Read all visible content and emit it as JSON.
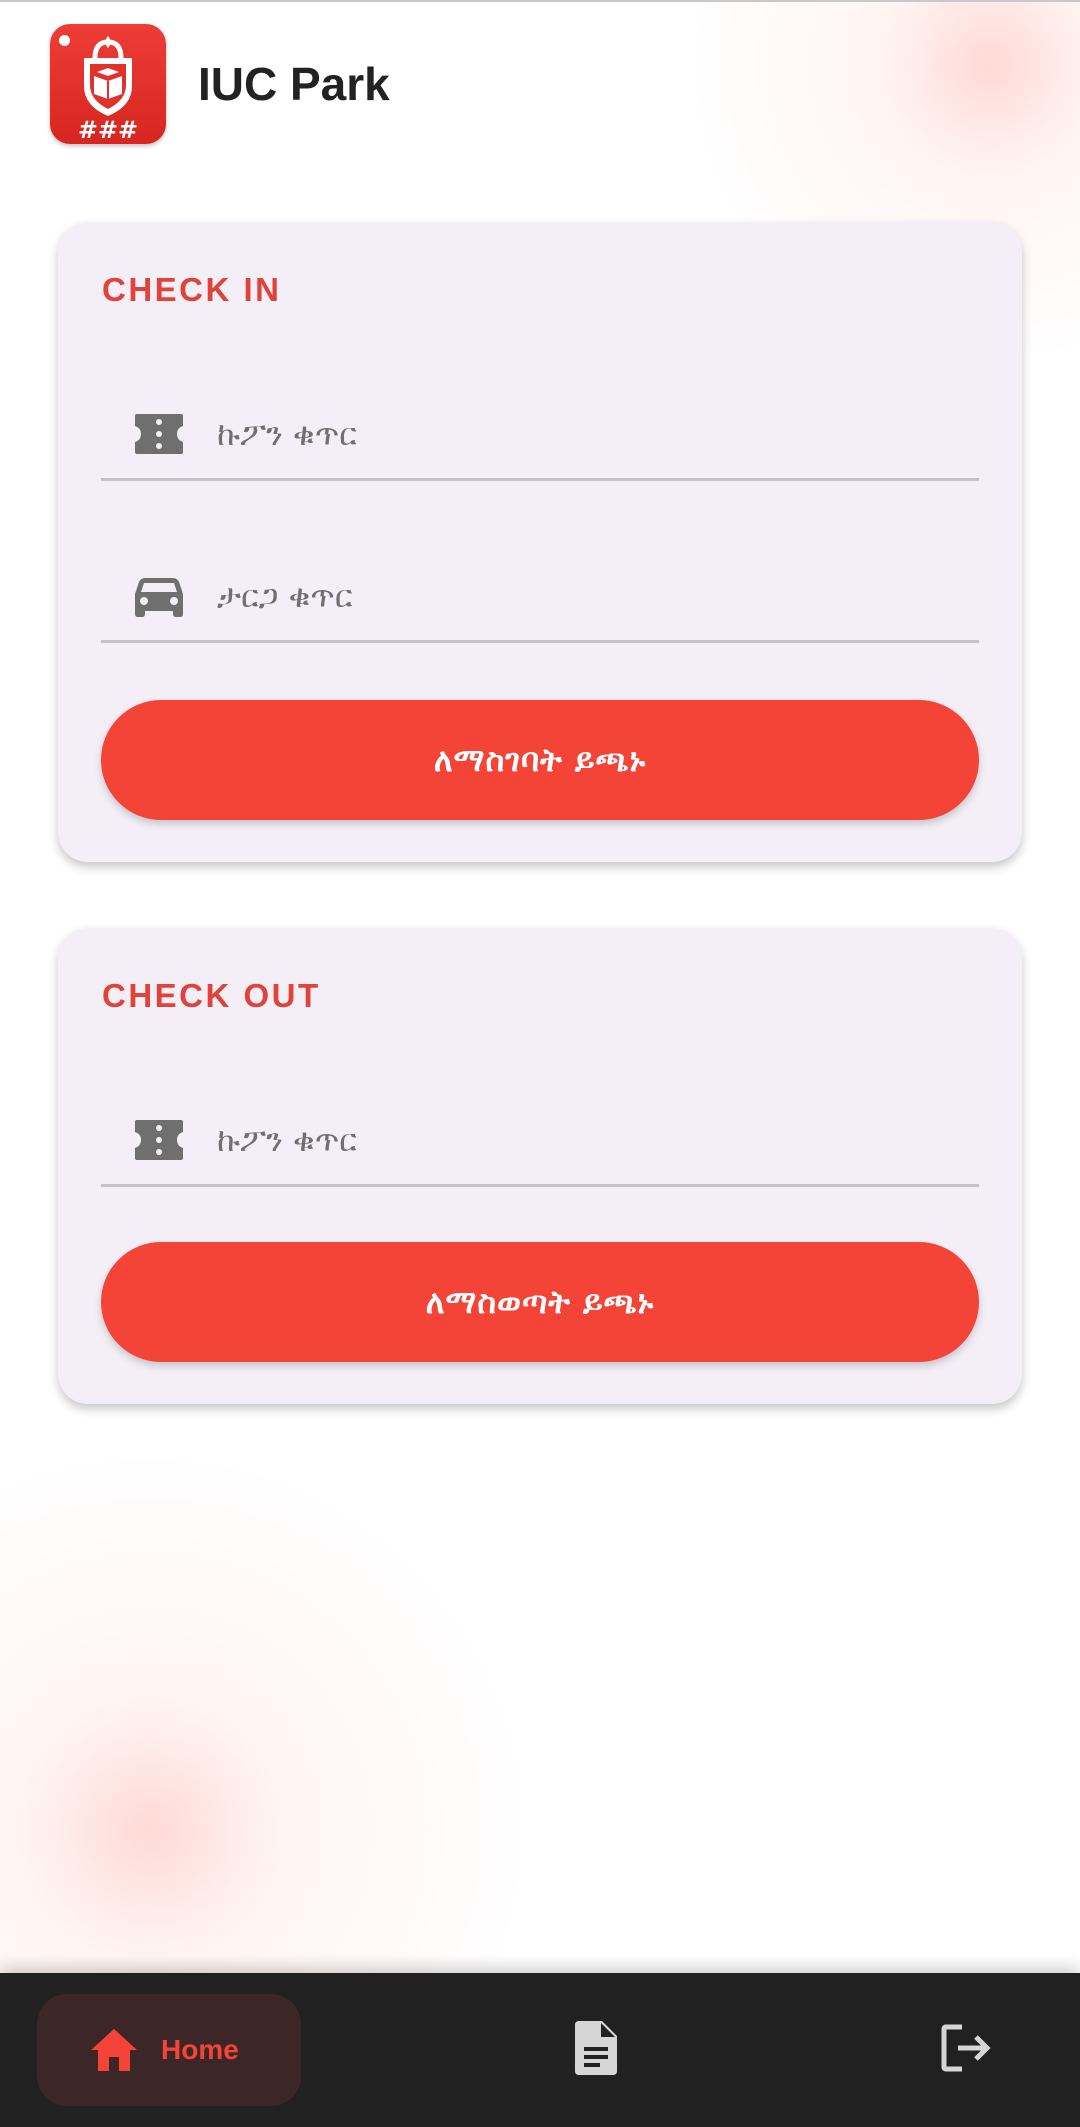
{
  "header": {
    "app_name": "IUC Park",
    "logo_icon": "shield-lock-book-icon",
    "logo_text": "###"
  },
  "check_in": {
    "title": "CHECK IN",
    "coupon_field": {
      "placeholder": "ኩፖን ቁጥር",
      "value": "",
      "icon": "ticket-icon"
    },
    "plate_field": {
      "placeholder": "ታርጋ ቁጥር",
      "value": "",
      "icon": "car-icon"
    },
    "button_label": "ለማስገባት ይጫኑ"
  },
  "check_out": {
    "title": "CHECK OUT",
    "coupon_field": {
      "placeholder": "ኩፖን ቁጥር",
      "value": "",
      "icon": "ticket-icon"
    },
    "button_label": "ለማስወጣት ይጫኑ"
  },
  "bottom_nav": {
    "items": [
      {
        "label": "Home",
        "icon": "home-icon",
        "active": true
      },
      {
        "label": "",
        "icon": "document-icon",
        "active": false
      },
      {
        "label": "",
        "icon": "logout-icon",
        "active": false
      }
    ]
  },
  "colors": {
    "accent": "#f44337",
    "title_red": "#e0433a",
    "card_bg": "#f4eff7",
    "nav_bg": "#222122",
    "nav_active_bg": "#3c2627",
    "icon_gray": "#6f6f6f"
  }
}
